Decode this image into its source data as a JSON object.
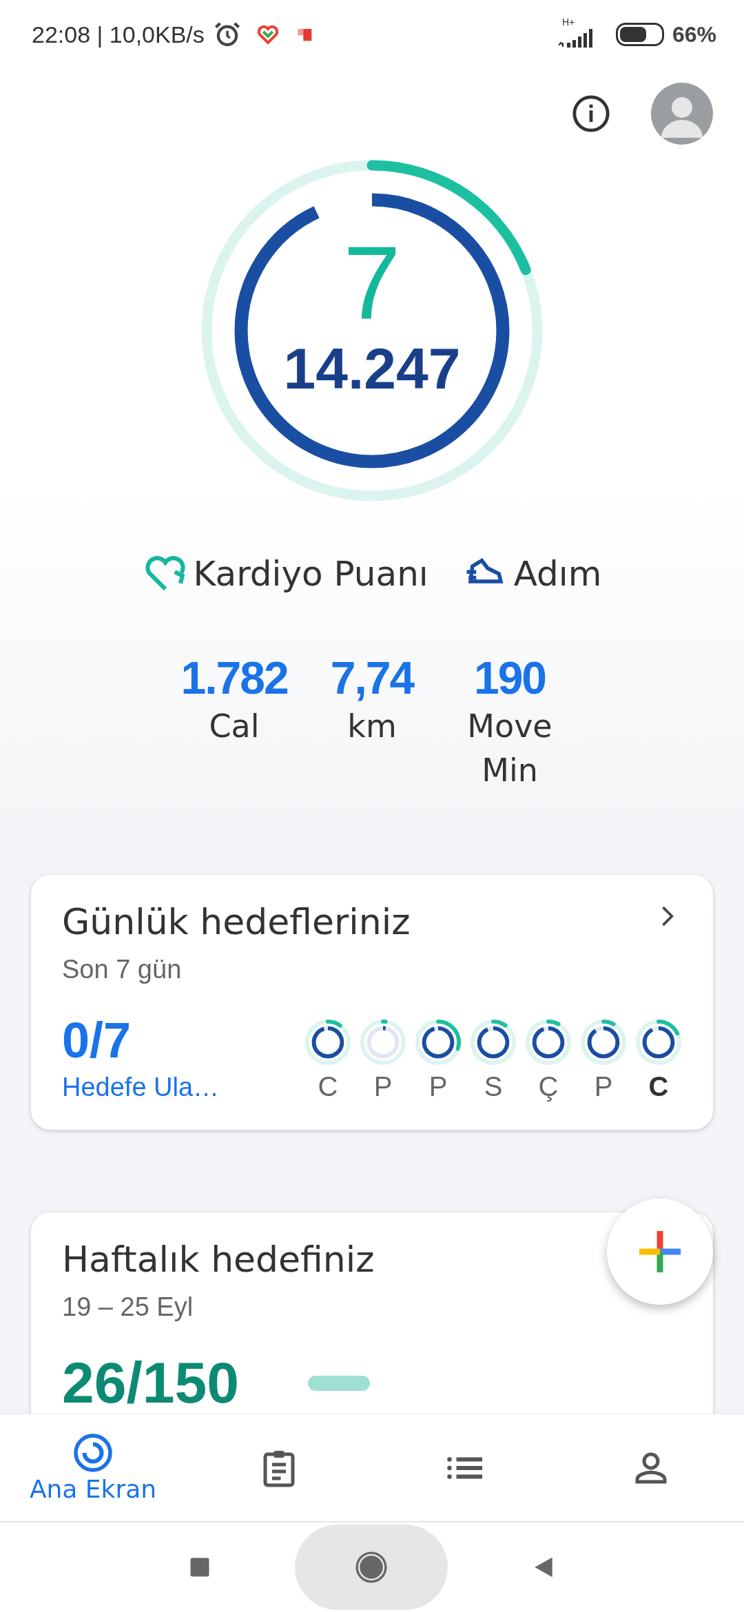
{
  "status_bar": {
    "time": "22:08 | 10,0KB/s",
    "network": "H+",
    "battery": "66%"
  },
  "summary": {
    "cardio_points": "7",
    "steps": "14.247",
    "cardio_ring": {
      "level": 0.19
    },
    "steps_ring": {
      "level": 0.93
    },
    "legend": [
      {
        "label": "Kardiyo Puanı",
        "kind": "cardio"
      },
      {
        "label": "Adım",
        "kind": "steps"
      }
    ],
    "stats": [
      {
        "value": "1.782",
        "label": "Cal"
      },
      {
        "value": "7,74",
        "label": "km"
      },
      {
        "value": "190",
        "label": "Move Min"
      }
    ]
  },
  "daily_goals": {
    "title": "Günlük hedefleriniz",
    "subtitle": "Son 7 gün",
    "count": "0/7",
    "caption": "Hedefe Ula…",
    "days": [
      {
        "label": "C",
        "cardio": {
          "level": 0.1
        },
        "steps": {
          "level": 0.95
        },
        "selected": false
      },
      {
        "label": "P",
        "cardio": {
          "level": 0.02
        },
        "steps": {
          "level": 0.03
        },
        "selected": false
      },
      {
        "label": "P",
        "cardio": {
          "level": 0.3
        },
        "steps": {
          "level": 0.95
        },
        "selected": false
      },
      {
        "label": "S",
        "cardio": {
          "level": 0.1
        },
        "steps": {
          "level": 0.93
        },
        "selected": false
      },
      {
        "label": "Ç",
        "cardio": {
          "level": 0.08
        },
        "steps": {
          "level": 0.94
        },
        "selected": false
      },
      {
        "label": "P",
        "cardio": {
          "level": 0.08
        },
        "steps": {
          "level": 0.9
        },
        "selected": false
      },
      {
        "label": "C",
        "cardio": {
          "level": 0.18
        },
        "steps": {
          "level": 0.92
        },
        "selected": true
      }
    ]
  },
  "weekly_goal": {
    "title": "Haftalık hedefiniz",
    "subtitle": "19 – 25 Eyl",
    "count": "26/150"
  },
  "bottom_nav": [
    {
      "label": "Ana Ekran",
      "selected": true
    },
    {
      "selected": false
    },
    {
      "selected": false
    },
    {
      "selected": false
    }
  ]
}
